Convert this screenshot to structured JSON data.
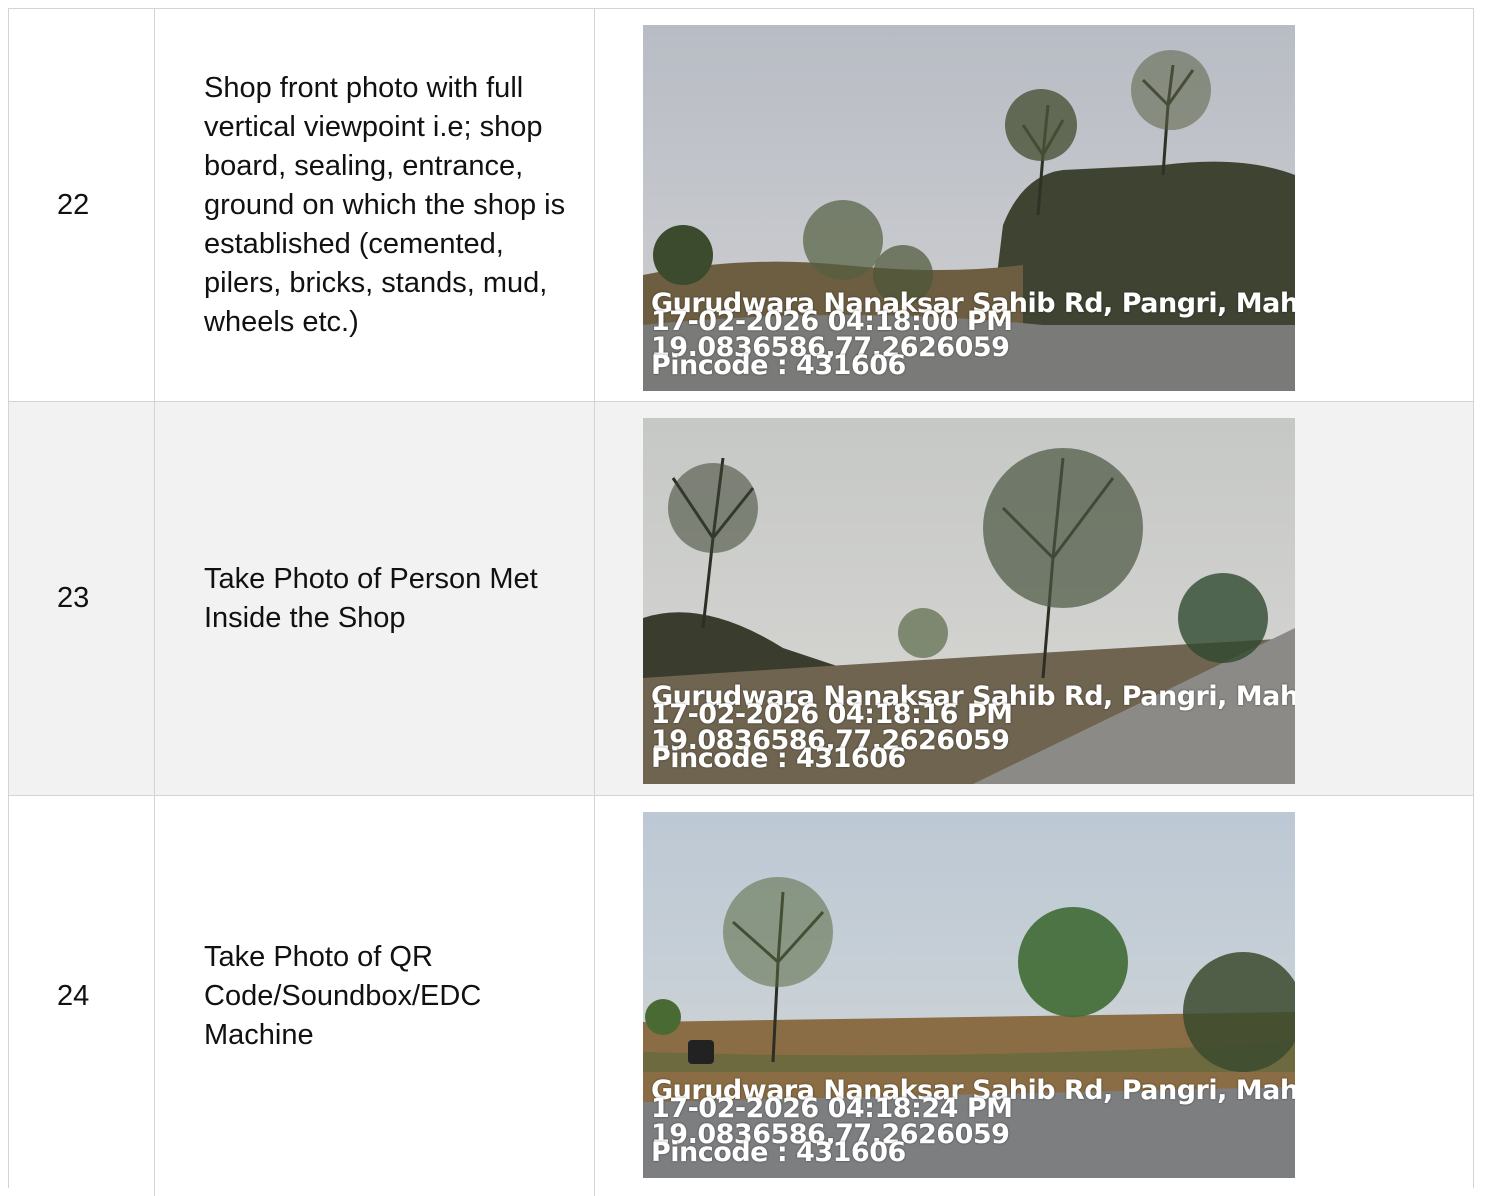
{
  "rows": [
    {
      "number": "22",
      "description": "Shop front photo with full vertical viewpoint i.e; shop board, sealing, entrance, ground on which the shop is established (cemented, pilers, bricks, stands, mud, wheels etc.)",
      "photo": {
        "address": "Gurudwara Nanaksar Sahib Rd, Pangri, Maha",
        "datetime": "17-02-2026 04:18:00 PM",
        "coords": "19.0836586,77.2626059",
        "pincode": "Pincode : 431606"
      }
    },
    {
      "number": "23",
      "description": "Take Photo of Person Met Inside the Shop",
      "photo": {
        "address": "Gurudwara Nanaksar Sahib Rd, Pangri, Maha",
        "datetime": "17-02-2026 04:18:16 PM",
        "coords": "19.0836586,77.2626059",
        "pincode": "Pincode : 431606"
      }
    },
    {
      "number": "24",
      "description": "Take Photo of QR Code/Soundbox/EDC Machine",
      "photo": {
        "address": "Gurudwara Nanaksar Sahib Rd, Pangri, Maha",
        "datetime": "17-02-2026 04:18:24 PM",
        "coords": "19.0836586,77.2626059",
        "pincode": "Pincode : 431606"
      }
    }
  ]
}
